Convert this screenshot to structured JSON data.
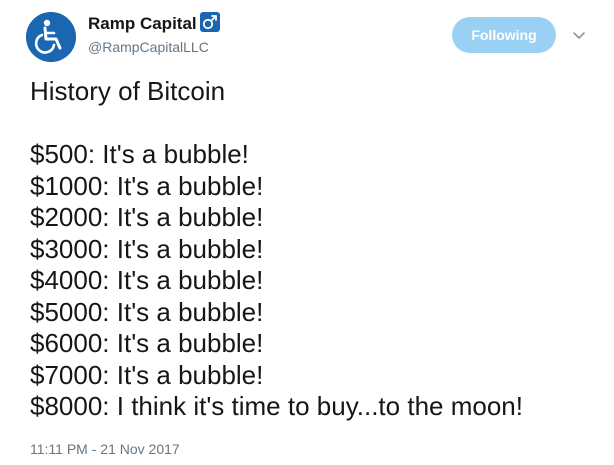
{
  "author": {
    "display_name": "Ramp Capital",
    "handle": "@RampCapitalLLC",
    "avatar_icon": "wheelchair-icon",
    "name_emoji_icon": "male-sign-emoji-icon",
    "avatar_color": "#1a66b0"
  },
  "follow_button": {
    "label": "Following",
    "color": "#9ad0f4"
  },
  "caret_icon": "chevron-down-icon",
  "tweet": {
    "lines": [
      "History of Bitcoin",
      "",
      "$500: It's a bubble!",
      "$1000: It's a bubble!",
      "$2000: It's a bubble!",
      "$3000: It's a bubble!",
      "$4000: It's a bubble!",
      "$5000: It's a bubble!",
      "$6000: It's a bubble!",
      "$7000: It's a bubble!",
      "$8000: I think it's time to buy...to the moon!"
    ],
    "timestamp": "11:11 PM - 21 Nov 2017"
  }
}
